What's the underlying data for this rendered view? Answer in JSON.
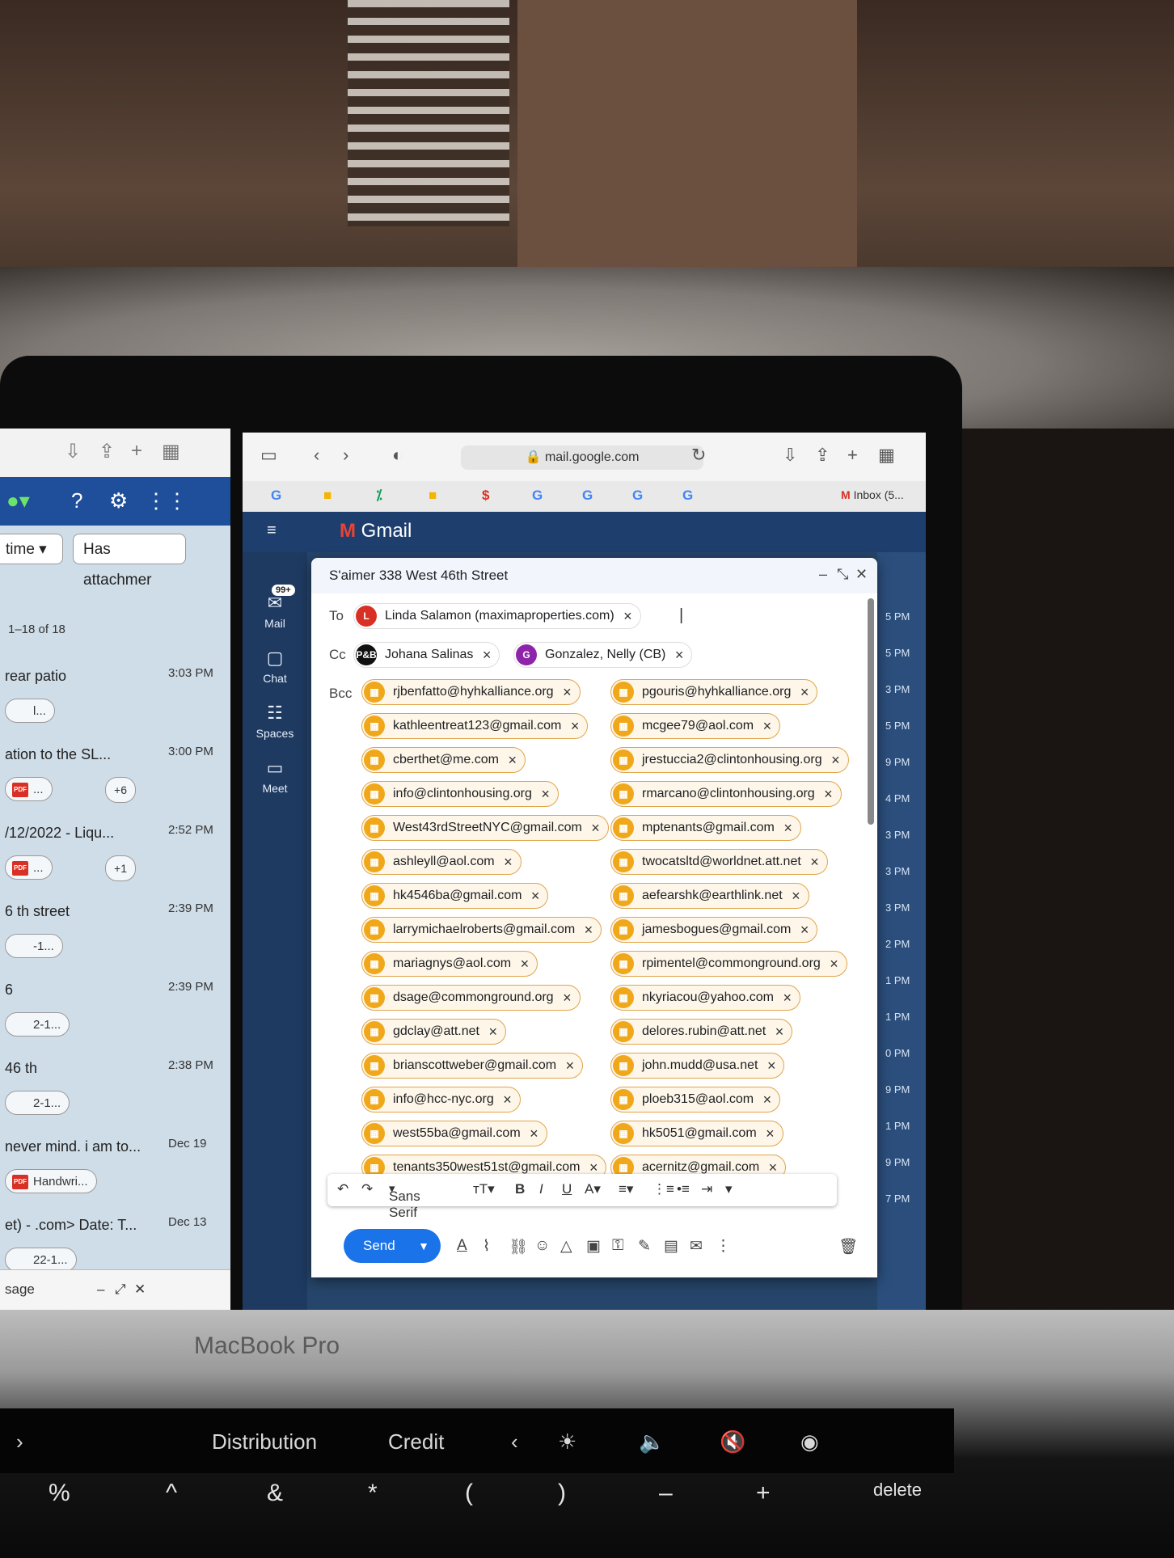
{
  "compose": {
    "title": "S'aimer 338 West 46th Street",
    "to_label": "To",
    "cc_label": "Cc",
    "bcc_label": "Bcc",
    "to": [
      {
        "initial": "L",
        "name": "Linda Salamon (maximaproperties.com)",
        "color": "#d93025"
      }
    ],
    "cc": [
      {
        "initial": "P&B",
        "name": "Johana Salinas",
        "color": "#111111"
      },
      {
        "initial": "G",
        "name": "Gonzalez, Nelly (CB)",
        "color": "#8e24aa"
      }
    ],
    "bcc": [
      "rjbenfatto@hyhkalliance.org",
      "pgouris@hyhkalliance.org",
      "kathleentreat123@gmail.com",
      "mcgee79@aol.com",
      "cberthet@me.com",
      "jrestuccia2@clintonhousing.org",
      "info@clintonhousing.org",
      "rmarcano@clintonhousing.org",
      "West43rdStreetNYC@gmail.com",
      "mptenants@gmail.com",
      "ashleyll@aol.com",
      "twocatsltd@worldnet.att.net",
      "hk4546ba@gmail.com",
      "aefearshk@earthlink.net",
      "larrymichaelroberts@gmail.com",
      "jamesbogues@gmail.com",
      "mariagnys@aol.com",
      "rpimentel@commonground.org",
      "dsage@commonground.org",
      "nkyriacou@yahoo.com",
      "gdclay@att.net",
      "delores.rubin@att.net",
      "brianscottweber@gmail.com",
      "john.mudd@usa.net",
      "info@hcc-nyc.org",
      "ploeb315@aol.com",
      "west55ba@gmail.com",
      "hk5051@gmail.com",
      "tenants350west51st@gmail.com",
      "acernitz@gmail.com"
    ],
    "font_name": "Sans Serif",
    "send_label": "Send"
  },
  "browser": {
    "url": "mail.google.com",
    "inbox_tab": "Inbox (5..."
  },
  "gmail": {
    "logo": "Gmail",
    "badge": "99+",
    "rail": [
      "Mail",
      "Chat",
      "Spaces",
      "Meet"
    ],
    "times": [
      "5 PM",
      "5 PM",
      "3 PM",
      "5 PM",
      "9 PM",
      "4 PM",
      "3 PM",
      "3 PM",
      "3 PM",
      "2 PM",
      "1 PM",
      "1 PM",
      "0 PM",
      "9 PM",
      "1 PM",
      "9 PM",
      "7 PM"
    ]
  },
  "left_window": {
    "filter_time": "time",
    "filter_attach": "Has attachmer",
    "count": "1–18 of 18",
    "rows": [
      {
        "subject": "rear patio",
        "time": "3:03 PM",
        "pill": "l...",
        "pdf": false,
        "more": ""
      },
      {
        "subject": "ation to the SL...",
        "time": "3:00 PM",
        "pill": "...",
        "pdf": true,
        "more": "+6"
      },
      {
        "subject": "/12/2022 - Liqu...",
        "time": "2:52 PM",
        "pill": "...",
        "pdf": true,
        "more": "+1"
      },
      {
        "subject": "6 th street",
        "time": "2:39 PM",
        "pill": "-1...",
        "pdf": false,
        "more": ""
      },
      {
        "subject": "6",
        "time": "2:39 PM",
        "pill": "2-1...",
        "pdf": false,
        "more": ""
      },
      {
        "subject": "46 th",
        "time": "2:38 PM",
        "pill": "2-1...",
        "pdf": false,
        "more": ""
      },
      {
        "subject": "never mind. i am to...",
        "time": "Dec 19",
        "pill": "Handwri...",
        "pdf": true,
        "more": ""
      },
      {
        "subject": "et) - .com> Date: T...",
        "time": "Dec 13",
        "pill": "22-1...",
        "pdf": false,
        "more": ""
      }
    ],
    "footer": "sage"
  },
  "laptop": {
    "brand": "MacBook Pro",
    "touchbar": [
      "Distribution",
      "Credit"
    ],
    "keys": [
      "%",
      "^",
      "&",
      "*",
      "(",
      ")",
      "–",
      "+",
      "delete"
    ]
  }
}
